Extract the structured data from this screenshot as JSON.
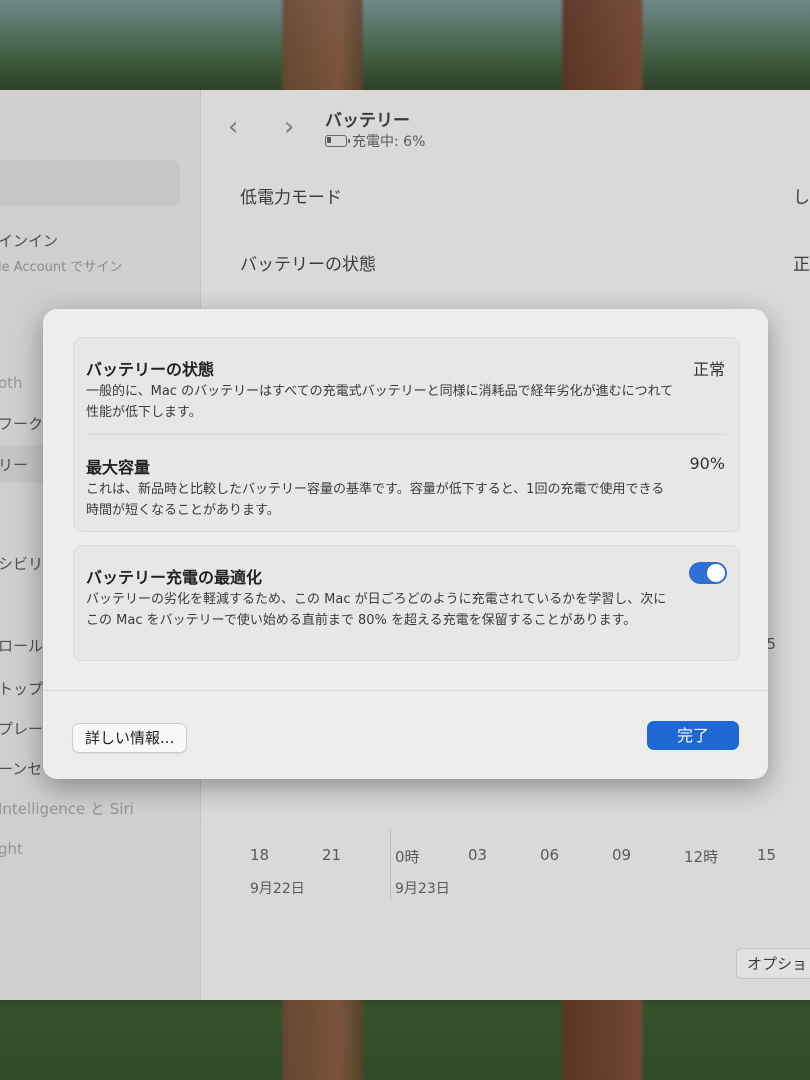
{
  "sidebar": {
    "sign_in_title": "インイン",
    "sign_in_sub": "le Account でサイン",
    "items": [
      "oth",
      "フーク",
      "リー",
      "シビリ",
      "ロール",
      "トップ",
      "プレー",
      "ーンセ",
      "Intelligence と Siri",
      "ght"
    ]
  },
  "header": {
    "title": "バッテリー",
    "status": "充電中: 6%",
    "nav_back": "‹",
    "nav_forward": "›"
  },
  "settings_rows": [
    {
      "label": "低電力モード",
      "edge": "し"
    },
    {
      "label": "バッテリーの状態",
      "edge": "正"
    }
  ],
  "usage_chart": {
    "ticks": [
      "18",
      "21",
      "0時",
      "03",
      "06",
      "09",
      "12時",
      "15"
    ],
    "dates": [
      "9月22日",
      "9月23日"
    ],
    "right_edge_value": "5"
  },
  "options_button": "オプショ",
  "sheet": {
    "battery_health": {
      "title": "バッテリーの状態",
      "value": "正常",
      "description": "一般的に、Mac のバッテリーはすべての充電式バッテリーと同様に消耗品で経年劣化が進むにつれて性能が低下します。"
    },
    "max_capacity": {
      "title": "最大容量",
      "value": "90%",
      "description": "これは、新品時と比較したバッテリー容量の基準です。容量が低下すると、1回の充電で使用できる時間が短くなることがあります。"
    },
    "optimized_charging": {
      "title": "バッテリー充電の最適化",
      "enabled": true,
      "description": "バッテリーの劣化を軽減するため、この Mac が日ごろどのように充電されているかを学習し、次にこの Mac をバッテリーで使い始める直前まで 80% を超える充電を保留することがあります。"
    },
    "details_button": "詳しい情報...",
    "done_button": "完了"
  },
  "colors": {
    "accent": "#1f67d2",
    "toggle_on": "#2f6fd6",
    "sheet_bg": "#eeedec"
  }
}
